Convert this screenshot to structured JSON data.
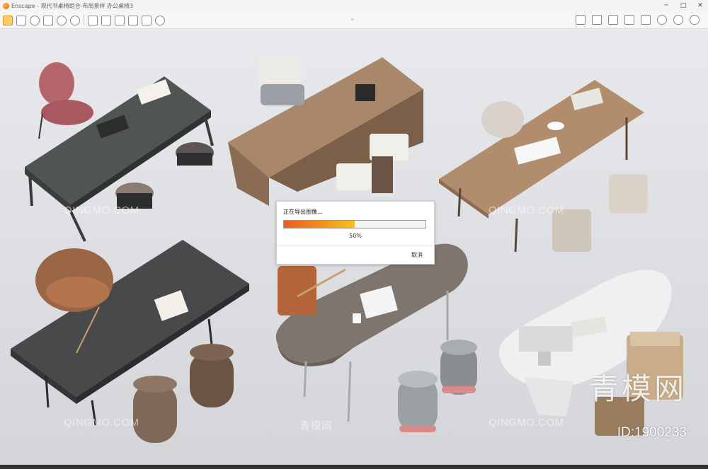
{
  "window": {
    "title": "Enscape - 现代书桌椅组合-布局景样 办公桌椅3",
    "minimize_glyph": "─",
    "maximize_glyph": "□",
    "close_glyph": "✕"
  },
  "toolbar": {
    "left_icons": [
      "enscape-logo-icon",
      "pencil-icon",
      "link-icon",
      "binoculars-icon",
      "camera-icon",
      "user-icon",
      "video-icon",
      "panorama-icon",
      "export-icon",
      "brush-icon",
      "layers-icon",
      "settings-icon"
    ],
    "right_icons": [
      "map-icon",
      "view-icon",
      "monitor-icon",
      "cube-icon",
      "tag-icon",
      "eye-icon",
      "gear-icon",
      "help-icon"
    ],
    "collapse_glyph": "⌃"
  },
  "dialog": {
    "title": "正在导出图像…",
    "progress": 50,
    "percent_label": "50%",
    "cancel_label": "取消",
    "colors": {
      "fill_start": "#ef5a1a",
      "fill_end": "#f8c01f"
    }
  },
  "watermarks": {
    "text": "QINGMO.COM",
    "cn_text": "青模网",
    "brand_big": "青模网",
    "id_label": "ID:1900233"
  }
}
